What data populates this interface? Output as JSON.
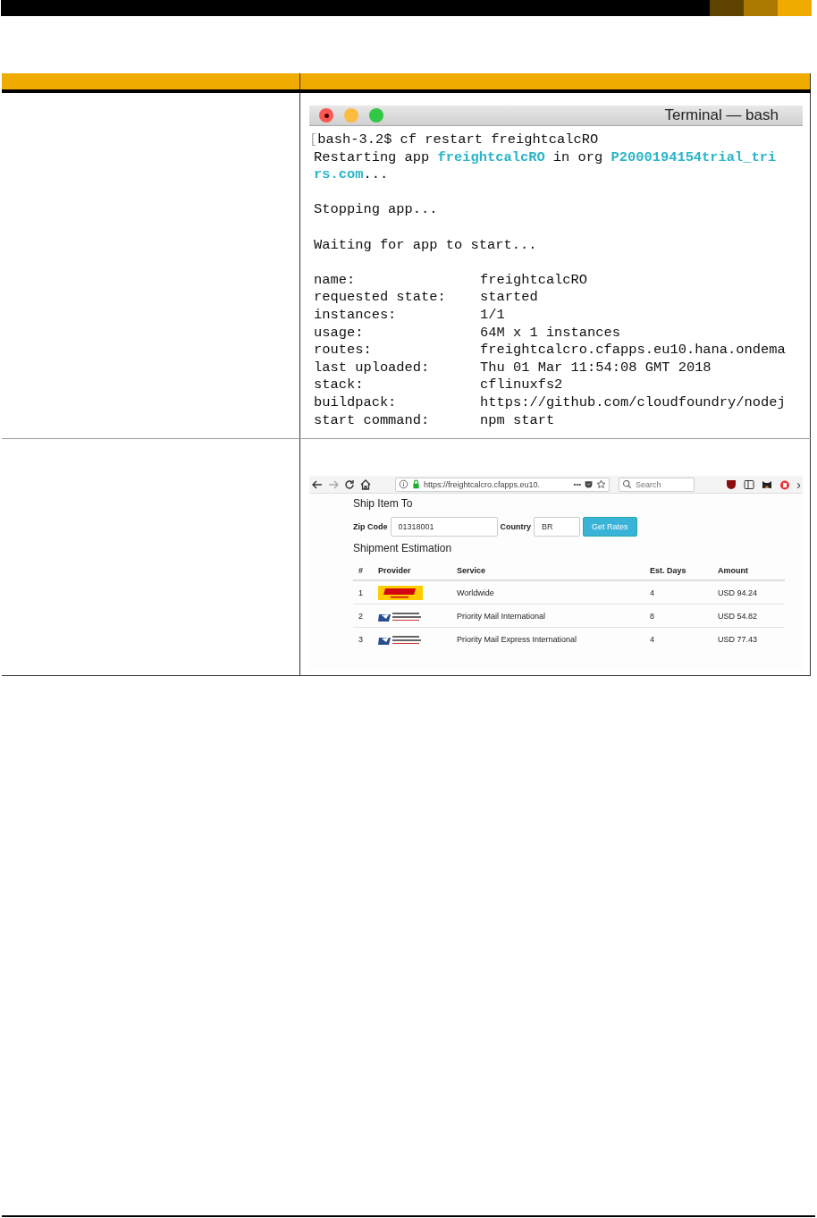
{
  "terminal": {
    "title": "Terminal — bash",
    "paragraphs": [
      [
        [
          {
            "text": "[",
            "kind": "mark"
          },
          {
            "text": "bash-3.2$ cf restart freightcalcRO",
            "kind": "plain"
          }
        ],
        [
          {
            "text": "Restarting app ",
            "kind": "plain"
          },
          {
            "text": "freightcalcRO",
            "kind": "link"
          },
          {
            "text": " in org ",
            "kind": "plain"
          },
          {
            "text": "P2000194154trial_tri",
            "kind": "link"
          }
        ],
        [
          {
            "text": "rs.com",
            "kind": "link"
          },
          {
            "text": "...",
            "kind": "plain"
          }
        ]
      ],
      [
        [
          {
            "text": "Stopping app...",
            "kind": "plain"
          }
        ]
      ],
      [
        [
          {
            "text": "Waiting for app to start...",
            "kind": "plain"
          }
        ]
      ]
    ],
    "details": [
      {
        "label": "name:",
        "value": "freightcalcRO"
      },
      {
        "label": "requested state:",
        "value": "started"
      },
      {
        "label": "instances:",
        "value": "1/1"
      },
      {
        "label": "usage:",
        "value": "64M x 1 instances"
      },
      {
        "label": "routes:",
        "value": "freightcalcro.cfapps.eu10.hana.ondema"
      },
      {
        "label": "last uploaded:",
        "value": "Thu 01 Mar 11:54:08 GMT 2018"
      },
      {
        "label": "stack:",
        "value": "cflinuxfs2"
      },
      {
        "label": "buildpack:",
        "value": "https://github.com/cloudfoundry/nodej"
      },
      {
        "label": "start command:",
        "value": "npm start"
      }
    ]
  },
  "browser": {
    "url": "https://freightcalcro.cfapps.eu10.",
    "more": "•••",
    "search": {
      "placeholder": "Search"
    },
    "overflow": "›",
    "heading": "Ship Item To",
    "fields": [
      {
        "label": "Zip Code",
        "value": "01318001",
        "kind": "wide"
      },
      {
        "label": "Country",
        "value": "BR",
        "kind": "narrow"
      }
    ],
    "button": "Get Rates",
    "subheading": "Shipment Estimation",
    "table": {
      "columns": [
        "#",
        "Provider",
        "Service",
        "Est. Days",
        "Amount"
      ],
      "rows": [
        {
          "number": "1",
          "kind": "dhl",
          "service": "Worldwide",
          "days": "4",
          "amount": "USD 94.24"
        },
        {
          "number": "2",
          "kind": "usps",
          "service": "Priority Mail International",
          "days": "8",
          "amount": "USD 54.82"
        },
        {
          "number": "3",
          "kind": "usps",
          "service": "Priority Mail Express International",
          "days": "4",
          "amount": "USD 77.43"
        }
      ]
    }
  }
}
